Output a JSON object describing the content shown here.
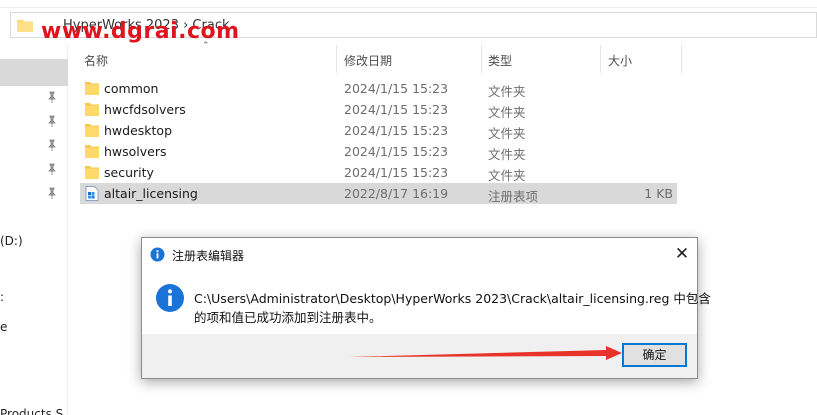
{
  "address_bar": {
    "path_text": "HyperWorks 2023 › Crack",
    "watermark": "www.dgrai.com"
  },
  "nav": {
    "labels": [
      "(D:)",
      ":",
      "e",
      "Products S"
    ]
  },
  "columns": {
    "name": "名称",
    "modified": "修改日期",
    "type": "类型",
    "size": "大小"
  },
  "files": [
    {
      "name": "common",
      "modified": "2024/1/15 15:23",
      "type": "文件夹",
      "size": "",
      "icon": "folder-icon"
    },
    {
      "name": "hwcfdsolvers",
      "modified": "2024/1/15 15:23",
      "type": "文件夹",
      "size": "",
      "icon": "folder-icon"
    },
    {
      "name": "hwdesktop",
      "modified": "2024/1/15 15:23",
      "type": "文件夹",
      "size": "",
      "icon": "folder-icon"
    },
    {
      "name": "hwsolvers",
      "modified": "2024/1/15 15:23",
      "type": "文件夹",
      "size": "",
      "icon": "folder-icon"
    },
    {
      "name": "security",
      "modified": "2024/1/15 15:23",
      "type": "文件夹",
      "size": "",
      "icon": "folder-icon"
    },
    {
      "name": "altair_licensing",
      "modified": "2022/8/17 16:19",
      "type": "注册表项",
      "size": "1 KB",
      "icon": "registry-file-icon"
    }
  ],
  "dialog": {
    "title": "注册表编辑器",
    "message_line1": "C:\\Users\\Administrator\\Desktop\\HyperWorks 2023\\Crack\\altair_licensing.reg 中包含",
    "message_line2": "的项和值已成功添加到注册表中。",
    "ok_label": "确定",
    "close_glyph": "✕"
  },
  "colors": {
    "selection": "#d9d9d9",
    "accent": "#0078d7",
    "annotation_arrow": "#e8332a",
    "watermark": "#e0141e"
  }
}
